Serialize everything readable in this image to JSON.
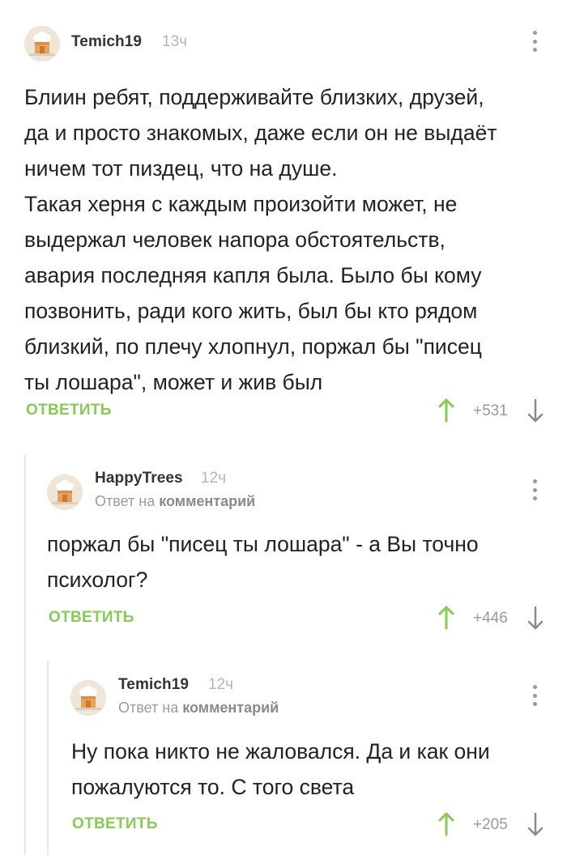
{
  "comments": [
    {
      "author": "Temich19",
      "time": "13ч",
      "lines": [
        "Блиин ребят, поддерживайте близких, друзей,",
        "да и просто знакомых, даже если он не выдаёт",
        "ничем тот пиздец, что на душе.",
        "Такая херня с каждым произойти может, не",
        "выдержал человек напора обстоятельств,",
        "авария последняя капля была. Было бы кому",
        "позвонить, ради кого жить, был бы кто рядом",
        "близкий, по плечу хлопнул, поржал бы \"писец",
        "ты лошара\", может и жив был"
      ],
      "reply_label": "ОТВЕТИТЬ",
      "score": "+531"
    },
    {
      "author": "HappyTrees",
      "time": "12ч",
      "reply_prefix": "Ответ на",
      "reply_target": "комментарий",
      "lines": [
        "поржал бы \"писец ты лошара\" - а Вы точно",
        "психолог?"
      ],
      "reply_label": "ОТВЕТИТЬ",
      "score": "+446"
    },
    {
      "author": "Temich19",
      "time": "12ч",
      "reply_prefix": "Ответ на",
      "reply_target": "комментарий",
      "lines": [
        "Ну пока никто не жаловался. Да и как они",
        "пожалуются то. С того света"
      ],
      "reply_label": "ОТВЕТИТЬ",
      "score": "+205"
    }
  ],
  "icons": {
    "more": "more-vertical-icon",
    "up": "arrow-up-icon",
    "down": "arrow-down-icon",
    "avatar": "default-avatar-icon"
  },
  "colors": {
    "accent": "#8ac858",
    "text": "#222222",
    "muted": "#9a9a9a"
  }
}
